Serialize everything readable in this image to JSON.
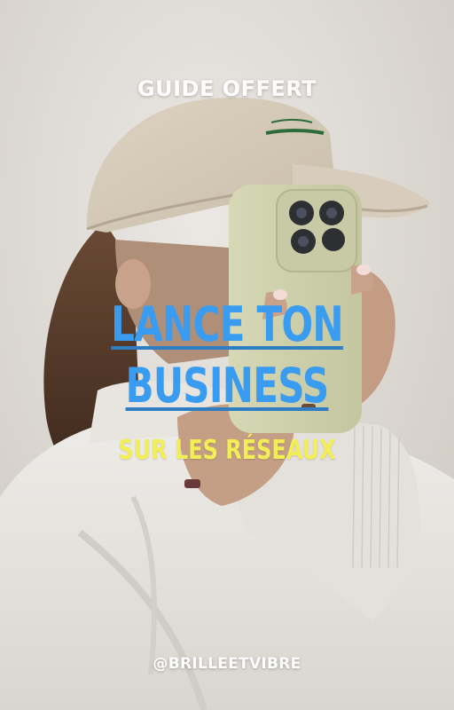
{
  "cover": {
    "kicker": "GUIDE OFFERT",
    "title_line_1": "LANCE TON",
    "title_line_2": "BUSINESS",
    "subtitle": "SUR LES RÉSEAUX",
    "handle": "@BRILLEETVIBRE"
  },
  "colors": {
    "title": "#3a9cf0",
    "subtitle": "#f2ee55",
    "kicker": "#ffffff",
    "background": "#dcd8d2"
  }
}
